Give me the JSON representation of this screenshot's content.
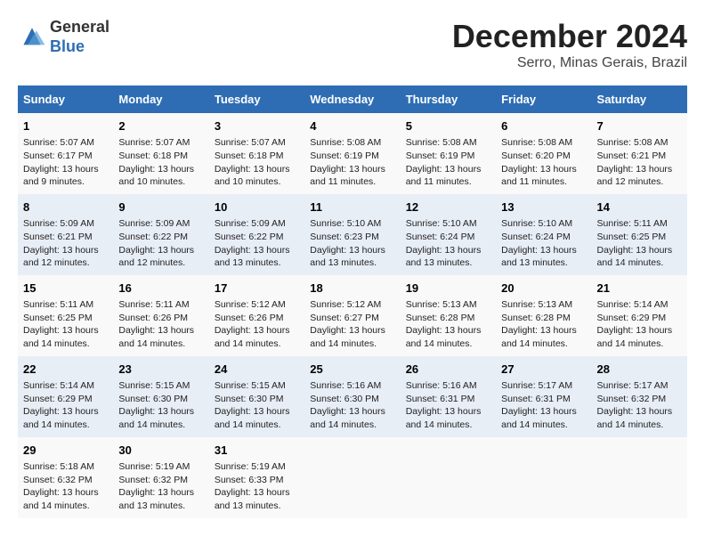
{
  "header": {
    "logo_line1": "General",
    "logo_line2": "Blue",
    "month_year": "December 2024",
    "location": "Serro, Minas Gerais, Brazil"
  },
  "days_of_week": [
    "Sunday",
    "Monday",
    "Tuesday",
    "Wednesday",
    "Thursday",
    "Friday",
    "Saturday"
  ],
  "weeks": [
    [
      {
        "day": "1",
        "info": "Sunrise: 5:07 AM\nSunset: 6:17 PM\nDaylight: 13 hours and 9 minutes."
      },
      {
        "day": "2",
        "info": "Sunrise: 5:07 AM\nSunset: 6:18 PM\nDaylight: 13 hours and 10 minutes."
      },
      {
        "day": "3",
        "info": "Sunrise: 5:07 AM\nSunset: 6:18 PM\nDaylight: 13 hours and 10 minutes."
      },
      {
        "day": "4",
        "info": "Sunrise: 5:08 AM\nSunset: 6:19 PM\nDaylight: 13 hours and 11 minutes."
      },
      {
        "day": "5",
        "info": "Sunrise: 5:08 AM\nSunset: 6:19 PM\nDaylight: 13 hours and 11 minutes."
      },
      {
        "day": "6",
        "info": "Sunrise: 5:08 AM\nSunset: 6:20 PM\nDaylight: 13 hours and 11 minutes."
      },
      {
        "day": "7",
        "info": "Sunrise: 5:08 AM\nSunset: 6:21 PM\nDaylight: 13 hours and 12 minutes."
      }
    ],
    [
      {
        "day": "8",
        "info": "Sunrise: 5:09 AM\nSunset: 6:21 PM\nDaylight: 13 hours and 12 minutes."
      },
      {
        "day": "9",
        "info": "Sunrise: 5:09 AM\nSunset: 6:22 PM\nDaylight: 13 hours and 12 minutes."
      },
      {
        "day": "10",
        "info": "Sunrise: 5:09 AM\nSunset: 6:22 PM\nDaylight: 13 hours and 13 minutes."
      },
      {
        "day": "11",
        "info": "Sunrise: 5:10 AM\nSunset: 6:23 PM\nDaylight: 13 hours and 13 minutes."
      },
      {
        "day": "12",
        "info": "Sunrise: 5:10 AM\nSunset: 6:24 PM\nDaylight: 13 hours and 13 minutes."
      },
      {
        "day": "13",
        "info": "Sunrise: 5:10 AM\nSunset: 6:24 PM\nDaylight: 13 hours and 13 minutes."
      },
      {
        "day": "14",
        "info": "Sunrise: 5:11 AM\nSunset: 6:25 PM\nDaylight: 13 hours and 14 minutes."
      }
    ],
    [
      {
        "day": "15",
        "info": "Sunrise: 5:11 AM\nSunset: 6:25 PM\nDaylight: 13 hours and 14 minutes."
      },
      {
        "day": "16",
        "info": "Sunrise: 5:11 AM\nSunset: 6:26 PM\nDaylight: 13 hours and 14 minutes."
      },
      {
        "day": "17",
        "info": "Sunrise: 5:12 AM\nSunset: 6:26 PM\nDaylight: 13 hours and 14 minutes."
      },
      {
        "day": "18",
        "info": "Sunrise: 5:12 AM\nSunset: 6:27 PM\nDaylight: 13 hours and 14 minutes."
      },
      {
        "day": "19",
        "info": "Sunrise: 5:13 AM\nSunset: 6:28 PM\nDaylight: 13 hours and 14 minutes."
      },
      {
        "day": "20",
        "info": "Sunrise: 5:13 AM\nSunset: 6:28 PM\nDaylight: 13 hours and 14 minutes."
      },
      {
        "day": "21",
        "info": "Sunrise: 5:14 AM\nSunset: 6:29 PM\nDaylight: 13 hours and 14 minutes."
      }
    ],
    [
      {
        "day": "22",
        "info": "Sunrise: 5:14 AM\nSunset: 6:29 PM\nDaylight: 13 hours and 14 minutes."
      },
      {
        "day": "23",
        "info": "Sunrise: 5:15 AM\nSunset: 6:30 PM\nDaylight: 13 hours and 14 minutes."
      },
      {
        "day": "24",
        "info": "Sunrise: 5:15 AM\nSunset: 6:30 PM\nDaylight: 13 hours and 14 minutes."
      },
      {
        "day": "25",
        "info": "Sunrise: 5:16 AM\nSunset: 6:30 PM\nDaylight: 13 hours and 14 minutes."
      },
      {
        "day": "26",
        "info": "Sunrise: 5:16 AM\nSunset: 6:31 PM\nDaylight: 13 hours and 14 minutes."
      },
      {
        "day": "27",
        "info": "Sunrise: 5:17 AM\nSunset: 6:31 PM\nDaylight: 13 hours and 14 minutes."
      },
      {
        "day": "28",
        "info": "Sunrise: 5:17 AM\nSunset: 6:32 PM\nDaylight: 13 hours and 14 minutes."
      }
    ],
    [
      {
        "day": "29",
        "info": "Sunrise: 5:18 AM\nSunset: 6:32 PM\nDaylight: 13 hours and 14 minutes."
      },
      {
        "day": "30",
        "info": "Sunrise: 5:19 AM\nSunset: 6:32 PM\nDaylight: 13 hours and 13 minutes."
      },
      {
        "day": "31",
        "info": "Sunrise: 5:19 AM\nSunset: 6:33 PM\nDaylight: 13 hours and 13 minutes."
      },
      {
        "day": "",
        "info": ""
      },
      {
        "day": "",
        "info": ""
      },
      {
        "day": "",
        "info": ""
      },
      {
        "day": "",
        "info": ""
      }
    ]
  ]
}
